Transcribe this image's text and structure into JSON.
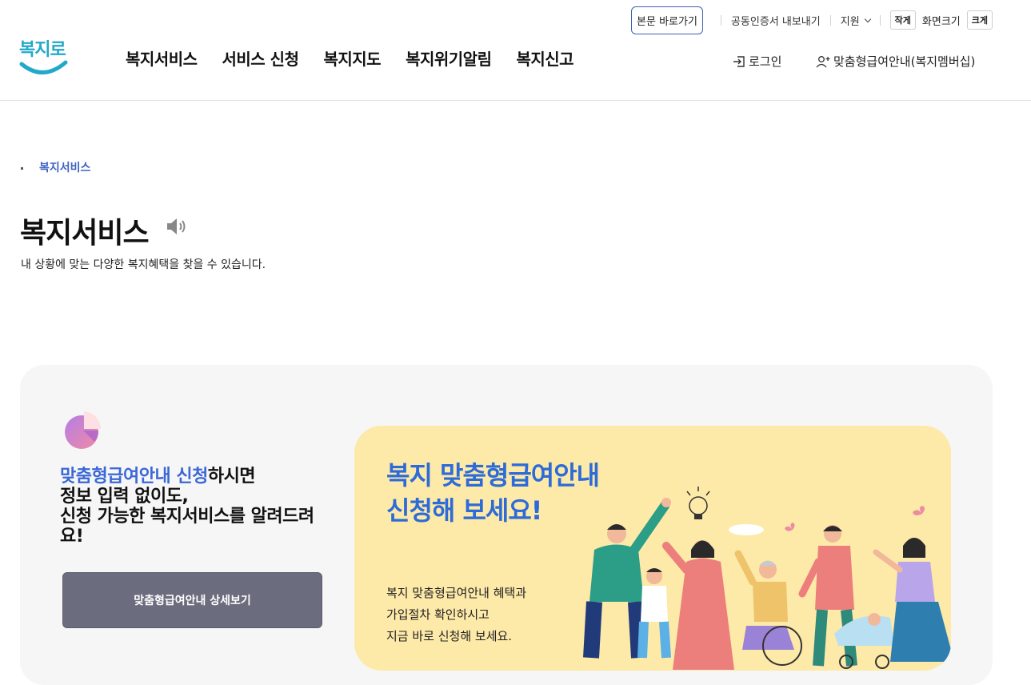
{
  "utility": {
    "skip_link": "본문 바로가기",
    "cert_export": "공동인증서 내보내기",
    "support": "지원",
    "size_small": "작게",
    "size_label": "화면크기",
    "size_large": "크게"
  },
  "header": {
    "logo_text": "복지로",
    "nav": [
      "복지서비스",
      "서비스 신청",
      "복지지도",
      "복지위기알림",
      "복지신고"
    ],
    "login": "로그인",
    "membership": "맞춤형급여안내(복지멤버십)"
  },
  "breadcrumb": "복지서비스",
  "page": {
    "title": "복지서비스",
    "description": "내 상황에 맞는 다양한 복지혜택을 찾을 수 있습니다."
  },
  "promo": {
    "highlight": "맞춤형급여안내 신청",
    "line1_rest": "하시면",
    "line2": "정보 입력 없이도,",
    "line3": "신청 가능한 복지서비스를 알려드려요!",
    "button": "맞춤형급여안내 상세보기"
  },
  "card": {
    "title_line1": "복지 맞춤형급여안내",
    "title_line2": "신청해 보세요!",
    "text_line1": "복지 맞춤형급여안내 혜택과",
    "text_line2": "가입절차 확인하시고",
    "text_line3": "지금 바로 신청해 보세요."
  },
  "colors": {
    "accent": "#3b68d6",
    "card_bg": "#fde9a8",
    "button_bg": "#6b6d7e",
    "logo": "#22a9c9"
  }
}
